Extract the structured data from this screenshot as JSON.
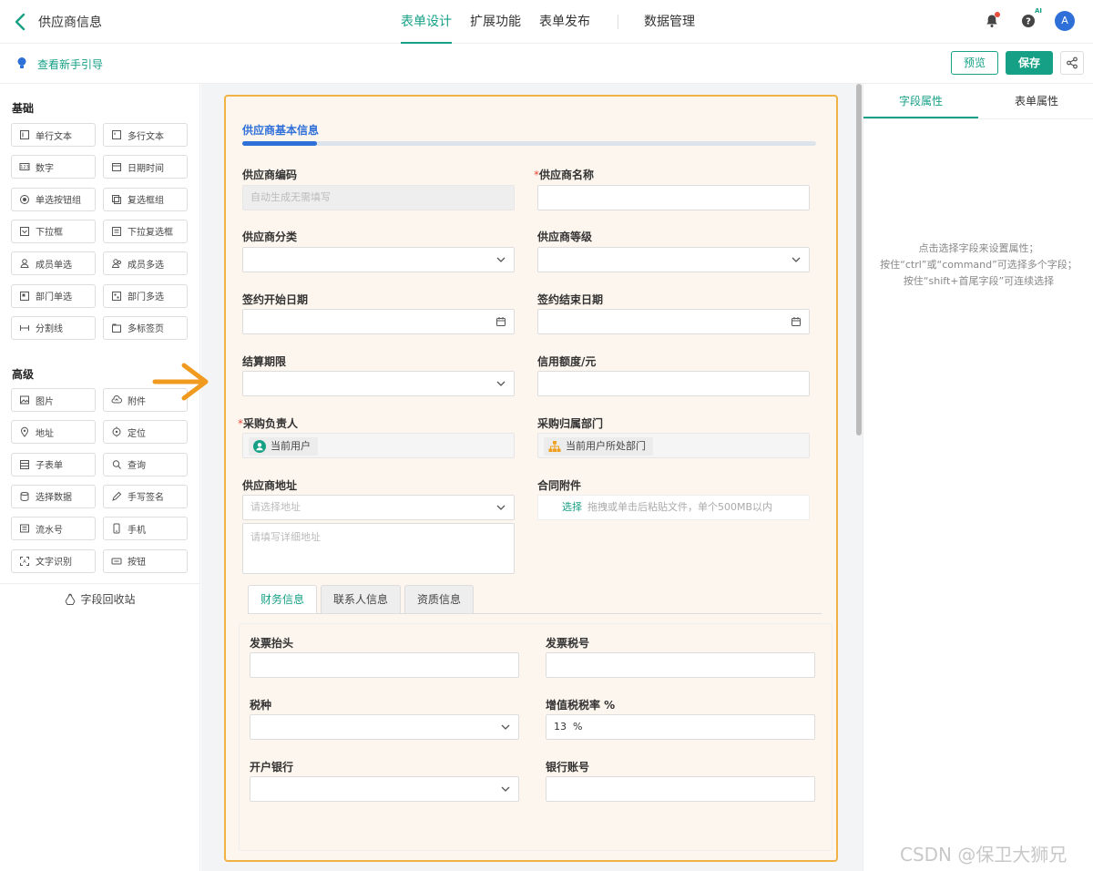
{
  "header": {
    "title": "供应商信息",
    "tabs": [
      "表单设计",
      "扩展功能",
      "表单发布",
      "数据管理"
    ],
    "ai_badge": "AI",
    "avatar_letter": "A"
  },
  "subbar": {
    "guide_label": "查看新手引导",
    "preview_label": "预览",
    "save_label": "保存"
  },
  "left": {
    "basic_title": "基础",
    "basic_items": [
      {
        "label": "单行文本",
        "icon": "single-line-text-icon"
      },
      {
        "label": "多行文本",
        "icon": "multi-line-text-icon"
      },
      {
        "label": "数字",
        "icon": "number-icon"
      },
      {
        "label": "日期时间",
        "icon": "calendar-icon"
      },
      {
        "label": "单选按钮组",
        "icon": "radio-icon"
      },
      {
        "label": "复选框组",
        "icon": "checkbox-icon"
      },
      {
        "label": "下拉框",
        "icon": "dropdown-icon"
      },
      {
        "label": "下拉复选框",
        "icon": "dropdown-multi-icon"
      },
      {
        "label": "成员单选",
        "icon": "member-icon"
      },
      {
        "label": "成员多选",
        "icon": "members-icon"
      },
      {
        "label": "部门单选",
        "icon": "department-icon"
      },
      {
        "label": "部门多选",
        "icon": "departments-icon"
      },
      {
        "label": "分割线",
        "icon": "divider-icon"
      },
      {
        "label": "多标签页",
        "icon": "tabs-icon"
      }
    ],
    "advanced_title": "高级",
    "advanced_items": [
      {
        "label": "图片",
        "icon": "image-icon"
      },
      {
        "label": "附件",
        "icon": "upload-icon"
      },
      {
        "label": "地址",
        "icon": "location-pin-icon"
      },
      {
        "label": "定位",
        "icon": "crosshair-icon"
      },
      {
        "label": "子表单",
        "icon": "subform-icon"
      },
      {
        "label": "查询",
        "icon": "query-icon"
      },
      {
        "label": "选择数据",
        "icon": "database-icon"
      },
      {
        "label": "手写签名",
        "icon": "pen-icon"
      },
      {
        "label": "流水号",
        "icon": "serial-number-icon"
      },
      {
        "label": "手机",
        "icon": "phone-icon"
      },
      {
        "label": "文字识别",
        "icon": "ocr-icon"
      },
      {
        "label": "按钮",
        "icon": "button-icon"
      }
    ],
    "recycle_label": "字段回收站"
  },
  "form": {
    "section_title": "供应商基本信息",
    "supplier_code": {
      "label": "供应商编码",
      "placeholder": "自动生成无需填写"
    },
    "supplier_name": {
      "label": "供应商名称",
      "required": "*"
    },
    "supplier_category": {
      "label": "供应商分类"
    },
    "supplier_level": {
      "label": "供应商等级"
    },
    "contract_start": {
      "label": "签约开始日期"
    },
    "contract_end": {
      "label": "签约结束日期"
    },
    "settlement_term": {
      "label": "结算期限"
    },
    "credit_limit": {
      "label": "信用额度/元"
    },
    "buyer": {
      "label": "采购负责人",
      "required": "*",
      "value": "当前用户"
    },
    "buyer_dept": {
      "label": "采购归属部门",
      "value": "当前用户所处部门"
    },
    "address": {
      "label": "供应商地址",
      "select_placeholder": "请选择地址",
      "detail_placeholder": "请填写详细地址"
    },
    "attachment": {
      "label": "合同附件",
      "select": "选择",
      "hint": "拖拽或单击后粘贴文件，单个500MB以内"
    },
    "subtabs": [
      "财务信息",
      "联系人信息",
      "资质信息"
    ],
    "finance": {
      "invoice_title": "发票抬头",
      "tax_number": "发票税号",
      "tax_type": "税种",
      "vat_rate": "增值税税率 %",
      "vat_rate_value": "13  %",
      "bank": "开户银行",
      "bank_account": "银行账号"
    }
  },
  "right": {
    "tabs": [
      "字段属性",
      "表单属性"
    ],
    "hint_lines": [
      "点击选择字段来设置属性；",
      "按住“ctrl”或“command”可选择多个字段；",
      "按住“shift+首尾字段”可连续选择"
    ]
  },
  "watermark": "CSDN @保卫大狮兄"
}
